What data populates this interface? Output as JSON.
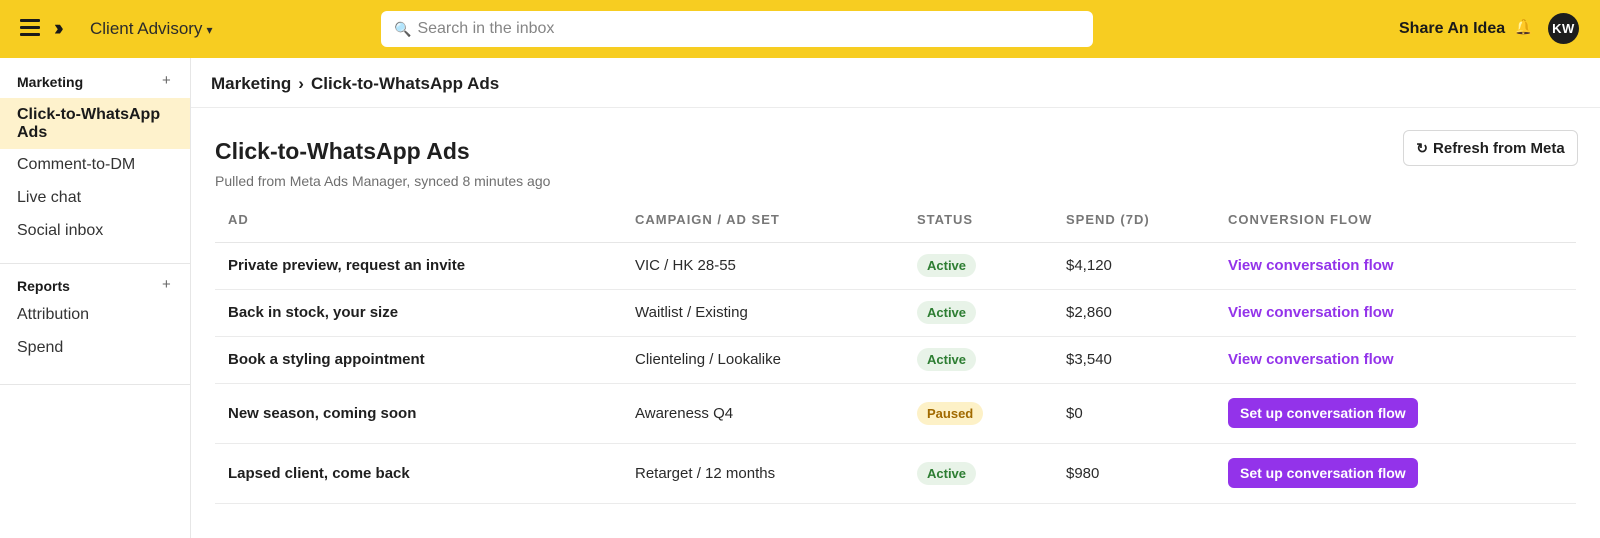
{
  "topbar": {
    "workspace": "Client Advisory",
    "workspace_caret": "▾",
    "search_placeholder": "Search in the inbox",
    "search_icon": "🔍",
    "share": "Share An Idea",
    "bell_icon": "🔔",
    "avatar_initials": "KW",
    "menu_icon": "hamburger-icon",
    "expand_icon": "double-chevron-right-icon"
  },
  "sidebar": {
    "sections": [
      {
        "title": "Marketing",
        "plus": "+",
        "items": [
          {
            "label": "Click-to-WhatsApp Ads",
            "active": true
          },
          {
            "label": "Comment-to-DM"
          },
          {
            "label": "Live chat"
          },
          {
            "label": "Social inbox"
          }
        ]
      },
      {
        "title": "Reports",
        "plus": "+",
        "items": [
          {
            "label": "Attribution"
          },
          {
            "label": "Spend"
          }
        ]
      }
    ]
  },
  "breadcrumb": {
    "parent": "Marketing",
    "separator": "›",
    "current": "Click-to-WhatsApp Ads"
  },
  "page": {
    "title": "Click-to-WhatsApp Ads",
    "subtitle": "Pulled from Meta Ads Manager, synced 8 minutes ago",
    "refresh_icon": "↻",
    "refresh_label": "Refresh from Meta"
  },
  "table": {
    "headers": [
      "AD",
      "CAMPAIGN / AD SET",
      "STATUS",
      "SPEND (7D)",
      "CONVERSION FLOW"
    ],
    "rows": [
      {
        "ad": "Private preview, request an invite",
        "campaign": "VIC / HK 28-55",
        "status": "Active",
        "spend": "$4,120",
        "flow": "View conversation flow"
      },
      {
        "ad": "Back in stock, your size",
        "campaign": "Waitlist / Existing",
        "status": "Active",
        "spend": "$2,860",
        "flow": "View conversation flow"
      },
      {
        "ad": "Book a styling appointment",
        "campaign": "Clienteling / Lookalike",
        "status": "Active",
        "spend": "$3,540",
        "flow": "View conversation flow"
      },
      {
        "ad": "New season, coming soon",
        "campaign": "Awareness Q4",
        "status": "Paused",
        "spend": "$0",
        "flow": "Set up conversation flow"
      },
      {
        "ad": "Lapsed client, come back",
        "campaign": "Retarget / 12 months",
        "status": "Active",
        "spend": "$980",
        "flow": "Set up conversation flow"
      }
    ]
  },
  "colors": {
    "topbar": "#f7cd21",
    "accent_purple": "#9333ea",
    "active_badge_bg": "#e8f3e8",
    "active_badge_text": "#2d7d32",
    "paused_badge_bg": "#fdf1c7",
    "paused_badge_text": "#a16a00",
    "sidebar_active_bg": "#fef2cc"
  }
}
